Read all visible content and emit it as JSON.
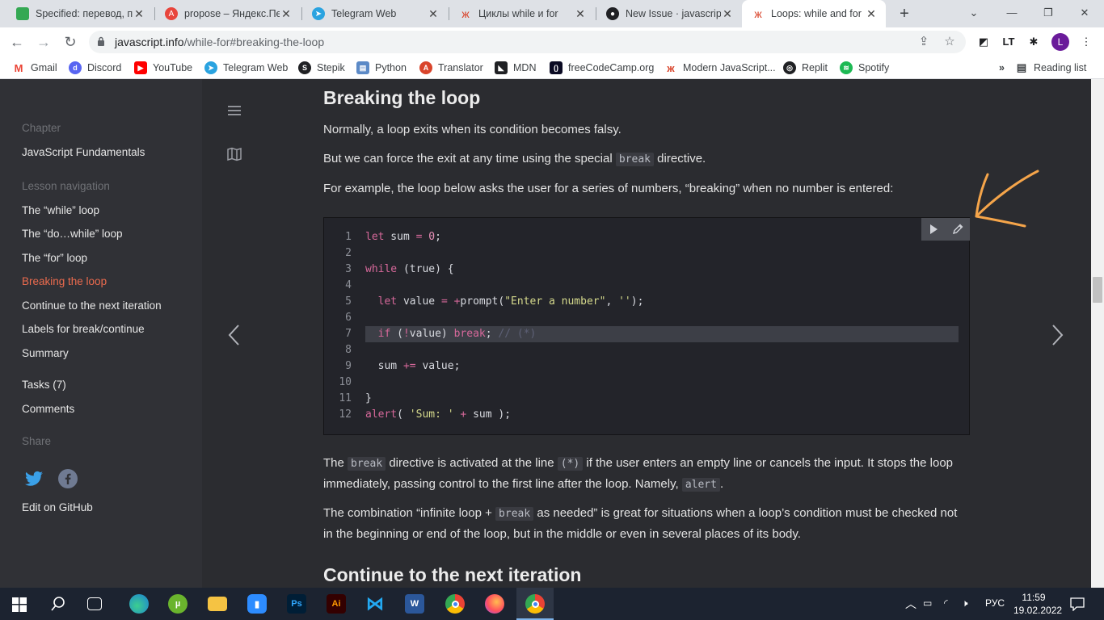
{
  "browser": {
    "tabs": [
      {
        "title": "Specified: перевод, пр",
        "icon": "green-square-icon",
        "color": "#34a853"
      },
      {
        "title": "propose – Яндекс.Пер",
        "icon": "yandex-translate-icon",
        "color": "#e8453c"
      },
      {
        "title": "Telegram Web",
        "icon": "telegram-icon",
        "color": "#2aa3e0"
      },
      {
        "title": "Циклы while и for",
        "icon": "javascript-info-icon",
        "color": "#d9442b"
      },
      {
        "title": "New Issue · javascript-",
        "icon": "github-icon",
        "color": "#202124"
      },
      {
        "title": "Loops: while and for",
        "icon": "javascript-info-icon",
        "color": "#d9442b",
        "active": true
      }
    ],
    "new_tab": "+",
    "address": {
      "host": "javascript.info",
      "path": "/while-for#breaking-the-loop"
    },
    "profile_initial": "L",
    "bookmarks": [
      {
        "label": "Gmail",
        "icon": "gmail-icon",
        "color": "#ea4335"
      },
      {
        "label": "Discord",
        "icon": "discord-icon",
        "color": "#5865f2"
      },
      {
        "label": "YouTube",
        "icon": "youtube-icon",
        "color": "#ff0000"
      },
      {
        "label": "Telegram Web",
        "icon": "telegram-icon",
        "color": "#2aa3e0"
      },
      {
        "label": "Stepik",
        "icon": "stepik-icon",
        "color": "#202124"
      },
      {
        "label": "Python",
        "icon": "book-icon",
        "color": "#5c8ac7"
      },
      {
        "label": "Translator",
        "icon": "translator-icon",
        "color": "#d9442b"
      },
      {
        "label": "MDN",
        "icon": "mdn-icon",
        "color": "#202124"
      },
      {
        "label": "freeCodeCamp.org",
        "icon": "freecodecamp-icon",
        "color": "#0a0a23"
      },
      {
        "label": "Modern JavaScript...",
        "icon": "javascript-info-icon",
        "color": "#d9442b"
      },
      {
        "label": "Replit",
        "icon": "replit-icon",
        "color": "#202124"
      },
      {
        "label": "Spotify",
        "icon": "spotify-icon",
        "color": "#1db954"
      }
    ],
    "more_bookmarks": "»",
    "reading_list": "Reading list"
  },
  "sidebar": {
    "chapter_heading": "Chapter",
    "chapter": "JavaScript Fundamentals",
    "lesson_heading": "Lesson navigation",
    "lessons": [
      {
        "label": "The “while” loop"
      },
      {
        "label": "The “do…while” loop"
      },
      {
        "label": "The “for” loop"
      },
      {
        "label": "Breaking the loop",
        "current": true
      },
      {
        "label": "Continue to the next iteration"
      },
      {
        "label": "Labels for break/continue"
      },
      {
        "label": "Summary"
      }
    ],
    "tasks": "Tasks (7)",
    "comments": "Comments",
    "share_heading": "Share",
    "edit_github": "Edit on GitHub"
  },
  "article": {
    "heading": "Breaking the loop",
    "p1": "Normally, a loop exits when its condition becomes falsy.",
    "p2_before": "But we can force the exit at any time using the special ",
    "p2_code": "break",
    "p2_after": " directive.",
    "p3": "For example, the loop below asks the user for a series of numbers, “breaking” when no number is entered:",
    "code_lines": [
      "1",
      "2",
      "3",
      "4",
      "5",
      "6",
      "7",
      "8",
      "9",
      "10",
      "11",
      "12"
    ],
    "p4_a": "The ",
    "p4_code1": "break",
    "p4_b": " directive is activated at the line ",
    "p4_code2": "(*)",
    "p4_c": " if the user enters an empty line or cancels the input. It stops the loop immediately, passing control to the first line after the loop. Namely, ",
    "p4_code3": "alert",
    "p4_d": ".",
    "p5_a": "The combination “infinite loop + ",
    "p5_code": "break",
    "p5_b": " as needed” is great for situations when a loop’s condition must be checked not in the beginning or end of the loop, but in the middle or even in several places of its body.",
    "next_heading": "Continue to the next iteration"
  },
  "taskbar": {
    "apps": [
      "windows-start-icon",
      "search-icon",
      "task-view-icon",
      "edge-icon",
      "utorrent-icon",
      "file-explorer-icon",
      "zoom-icon",
      "photoshop-icon",
      "illustrator-icon",
      "vscode-icon",
      "word-icon",
      "chrome-icon",
      "firefox-icon",
      "chrome-profile-icon"
    ],
    "language": "РУС",
    "time": "11:59",
    "date": "19.02.2022"
  }
}
